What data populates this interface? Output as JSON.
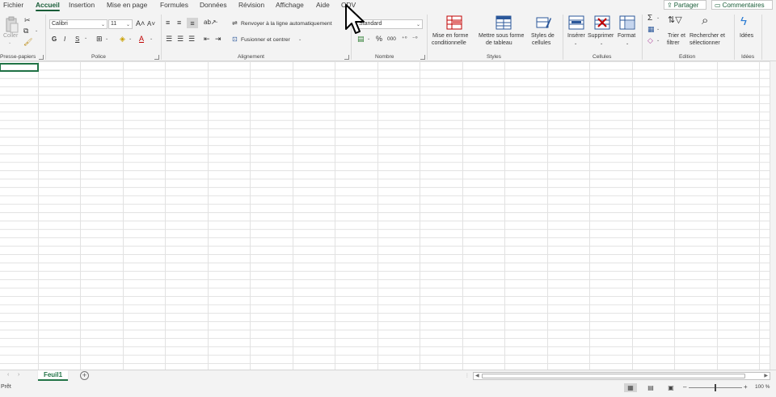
{
  "tabs": {
    "fichier": "Fichier",
    "accueil": "Accueil",
    "insertion": "Insertion",
    "mise_en_page": "Mise en page",
    "formules": "Formules",
    "donnees": "Données",
    "revision": "Révision",
    "affichage": "Affichage",
    "aide": "Aide",
    "odv": "ODV"
  },
  "header_buttons": {
    "share": "Partager",
    "comments": "Commentaires"
  },
  "ribbon": {
    "clipboard": {
      "paste": "Coller",
      "group": "Presse-papiers"
    },
    "font": {
      "group": "Police",
      "name": "Calibri",
      "size": "11",
      "bold": "G",
      "italic": "I",
      "underline": "S",
      "strike": "S",
      "grow": "A˄",
      "shrink": "A˅"
    },
    "alignment": {
      "group": "Alignement",
      "wrap": "Renvoyer à la ligne automatiquement",
      "merge": "Fusionner et centrer"
    },
    "number": {
      "group": "Nombre",
      "format": "Standard",
      "percent": "%",
      "thousands": "000"
    },
    "styles": {
      "group": "Styles",
      "conditional": "Mise en forme",
      "conditional2": "conditionnelle",
      "table": "Mettre sous forme",
      "table2": "de tableau",
      "cellstyles": "Styles de",
      "cellstyles2": "cellules"
    },
    "cells": {
      "group": "Cellules",
      "insert": "Insérer",
      "delete": "Supprimer",
      "format": "Format"
    },
    "editing": {
      "group": "Edition",
      "sort": "Trier et",
      "sort2": "filtrer",
      "find": "Rechercher et",
      "find2": "sélectionner"
    },
    "ideas": {
      "group": "Idées",
      "ideas": "Idées"
    }
  },
  "sheets": {
    "active": "Feuil1"
  },
  "status": {
    "ready": "Prêt",
    "zoom": "100 %"
  },
  "colors": {
    "accent": "#217346",
    "tab_active": "#185c37",
    "ribbon_bg": "#f3f3f3"
  }
}
